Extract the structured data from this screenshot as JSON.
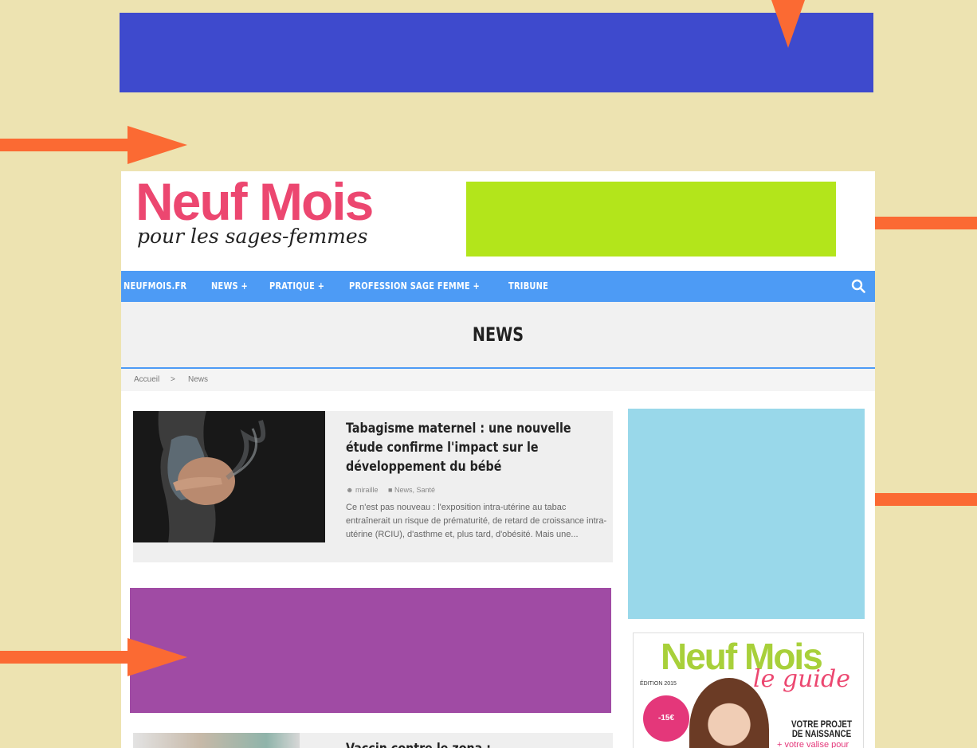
{
  "brand": {
    "name": "Neuf Mois",
    "tagline": "pour les sages-femmes",
    "primary_color": "#ec4770",
    "nav_color": "#4d9bf5"
  },
  "nav": {
    "items": [
      {
        "label": "NEUFMOIS.FR"
      },
      {
        "label": "NEWS +"
      },
      {
        "label": "PRATIQUE +"
      },
      {
        "label": "PROFESSION SAGE FEMME +"
      },
      {
        "label": "TRIBUNE"
      }
    ],
    "search_icon": "search-icon"
  },
  "page": {
    "title": "NEWS"
  },
  "breadcrumb": {
    "home": "Accueil",
    "separator": ">",
    "current": "News"
  },
  "articles": [
    {
      "title": "Tabagisme maternel : une nouvelle étude confirme l'impact sur le développement du bébé",
      "author": "miraille",
      "categories": "News, Santé",
      "excerpt": "Ce n'est pas nouveau : l'exposition intra-utérine au tabac entraînerait un risque de prématurité, de retard de croissance intra-utérine (RCIU), d'asthme et, plus tard, d'obésité. Mais une..."
    },
    {
      "title": "Vaccin contre le zona : ..."
    }
  ],
  "ads": {
    "top_color": "#3e4acd",
    "header_color": "#b3e51b",
    "sidebar_color": "#99d8ea",
    "inline_color": "#a04ba4"
  },
  "guide": {
    "logo": "Neuf Mois",
    "subtitle": "le guide",
    "edition": "ÉDITION 2015",
    "badge": "-15€",
    "project": "VOTRE PROJET DE NAISSANCE",
    "suitcase": "+ votre valise pour"
  },
  "annotations": {
    "arrow_color": "#fb6a33"
  }
}
